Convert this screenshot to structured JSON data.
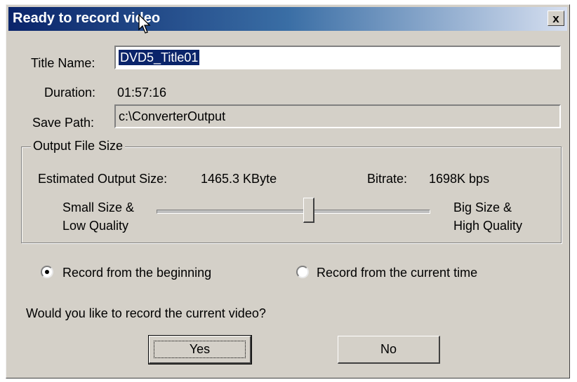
{
  "dialog": {
    "title": "Ready to record video",
    "close_glyph": "x"
  },
  "fields": {
    "title_name_label": "Title Name:",
    "title_name_value": "DVD5_Title01",
    "duration_label": "Duration:",
    "duration_value": "01:57:16",
    "save_path_label": "Save Path:",
    "save_path_value": "c:\\ConverterOutput"
  },
  "output_group": {
    "legend": "Output File Size",
    "estimated_label": "Estimated Output Size:",
    "estimated_value": "1465.3 KByte",
    "bitrate_label": "Bitrate:",
    "bitrate_value": "1698K bps",
    "small_line1": "Small Size &",
    "small_line2": "Low Quality",
    "big_line1": "Big Size &",
    "big_line2": "High Quality",
    "slider_fraction": 0.56
  },
  "record_options": {
    "beginning_label": "Record from the beginning",
    "current_label": "Record from the current time",
    "selected": "beginning"
  },
  "prompt": "Would you like to record the current video?",
  "buttons": {
    "yes": "Yes",
    "no": "No"
  },
  "colors": {
    "dialog_bg": "#d4d0c8",
    "titlebar_start": "#0a246a",
    "selection": "#0a246a"
  },
  "icons": {
    "cursor": "arrow-cursor-icon",
    "close": "close-icon"
  }
}
